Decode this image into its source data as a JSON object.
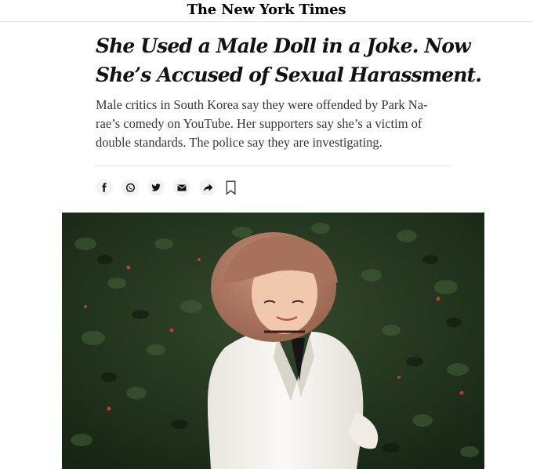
{
  "masthead": {
    "logo_text": "The New York Times"
  },
  "article": {
    "headline": "She Used a Male Doll in a Joke. Now She’s Accused of Sexual Harassment.",
    "summary": "Male critics in South Korea say they were offended by Park Na-rae’s comedy on YouTube. Her supporters say she’s a victim of double standards. The police say they are investigating."
  },
  "share": {
    "icons": [
      "facebook-icon",
      "whatsapp-icon",
      "twitter-icon",
      "email-icon",
      "share-arrow-icon",
      "bookmark-icon"
    ]
  },
  "colors": {
    "text": "#121212",
    "summary_text": "#363636",
    "rule": "#e2e2e2",
    "share_button_bg": "#f3f3f3",
    "foliage": "#1f2f1d",
    "jacket": "#f4f2ee",
    "hair": "#b07a66"
  }
}
